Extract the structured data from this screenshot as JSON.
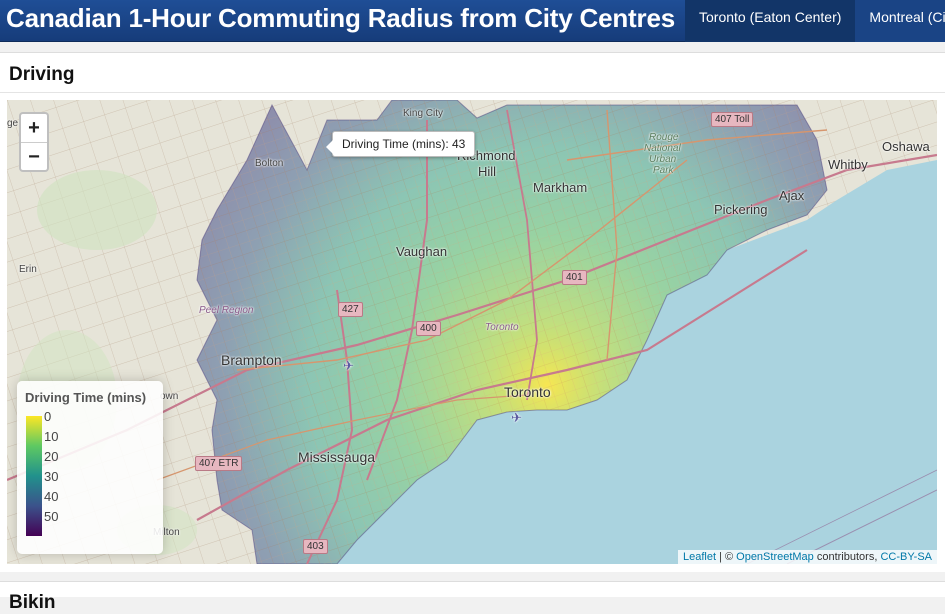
{
  "header": {
    "title": "Canadian 1-Hour Commuting Radius from City Centres",
    "tabs": [
      {
        "label": "Toronto (Eaton Center)",
        "active": true
      },
      {
        "label": "Montreal (Ci",
        "active": false
      }
    ]
  },
  "section": {
    "title": "Driving",
    "next_title": "Bikin"
  },
  "map": {
    "zoom_in": "+",
    "zoom_out": "−",
    "tooltip": "Driving Time (mins): 43",
    "places": {
      "king_city": "King City",
      "bolton": "Bolton",
      "richmond_hill_1": "Richmond",
      "richmond_hill_2": "Hill",
      "markham": "Markham",
      "rouge_1": "Rouge",
      "rouge_2": "National",
      "rouge_3": "Urban",
      "rouge_4": "Park",
      "whitby": "Whitby",
      "oshawa": "Oshawa",
      "ajax": "Ajax",
      "pickering": "Pickering",
      "vaughan": "Vaughan",
      "erin": "Erin",
      "peel": "Peel Region",
      "brampton": "Brampton",
      "toronto_small": "Toronto",
      "toronto": "Toronto",
      "mississauga": "Mississauga",
      "milton": "Milton",
      "georgetown": "own",
      "left_edge": "ge"
    },
    "shields": {
      "s407toll": "407 Toll",
      "s401": "401",
      "s427": "427",
      "s400": "400",
      "s407etr": "407 ETR",
      "s403": "403"
    },
    "colors": {
      "water": "#aad3df",
      "land": "#e8e6dc",
      "overlay_low": "#fde725",
      "overlay_high": "#440154"
    }
  },
  "legend": {
    "title": "Driving Time (mins)",
    "ticks": [
      "0",
      "10",
      "20",
      "30",
      "40",
      "50"
    ],
    "scale": [
      "#fde725",
      "#5ec962",
      "#21918c",
      "#3b528b",
      "#440154"
    ]
  },
  "attribution": {
    "leaflet": "Leaflet",
    "sep": " | © ",
    "osm": "OpenStreetMap",
    "contrib": " contributors, ",
    "license": "CC-BY-SA"
  }
}
